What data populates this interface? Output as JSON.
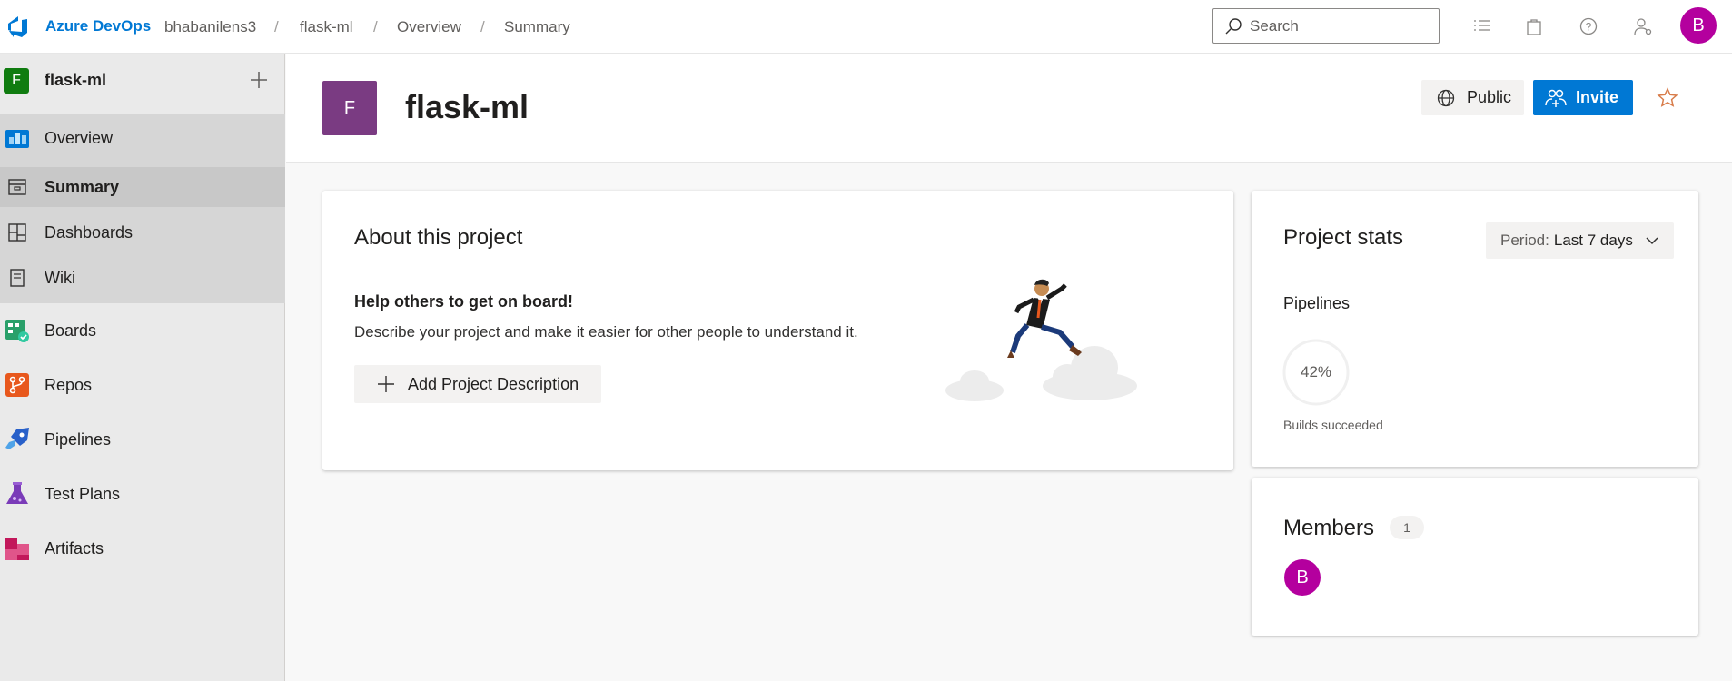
{
  "topbar": {
    "brand": "Azure DevOps",
    "breadcrumbs": [
      "bhabanilens3",
      "flask-ml",
      "Overview",
      "Summary"
    ],
    "search_placeholder": "Search",
    "user_initial": "B"
  },
  "sidebar": {
    "project_initial": "F",
    "project_name": "flask-ml",
    "items": [
      {
        "label": "Overview",
        "icon": "overview-icon"
      },
      {
        "label": "Summary",
        "icon": "summary-icon"
      },
      {
        "label": "Dashboards",
        "icon": "dashboards-icon"
      },
      {
        "label": "Wiki",
        "icon": "wiki-icon"
      },
      {
        "label": "Boards",
        "icon": "boards-icon"
      },
      {
        "label": "Repos",
        "icon": "repos-icon"
      },
      {
        "label": "Pipelines",
        "icon": "pipelines-icon"
      },
      {
        "label": "Test Plans",
        "icon": "test-plans-icon"
      },
      {
        "label": "Artifacts",
        "icon": "artifacts-icon"
      }
    ]
  },
  "header": {
    "project_initial": "F",
    "title": "flask-ml",
    "public_label": "Public",
    "invite_label": "Invite"
  },
  "about": {
    "title": "About this project",
    "subtitle": "Help others to get on board!",
    "description": "Describe your project and make it easier for other people to understand it.",
    "add_button": "Add Project Description"
  },
  "stats": {
    "title": "Project stats",
    "period_label": "Period:",
    "period_value": "Last 7 days",
    "section": "Pipelines",
    "percent_text": "42%",
    "percent_value": 42,
    "caption": "Builds succeeded"
  },
  "members": {
    "title": "Members",
    "count": "1",
    "avatar_initial": "B"
  },
  "colors": {
    "accent": "#0078d4",
    "project_badge": "#7a3b82",
    "avatar": "#b4009e",
    "success": "#107c10"
  }
}
